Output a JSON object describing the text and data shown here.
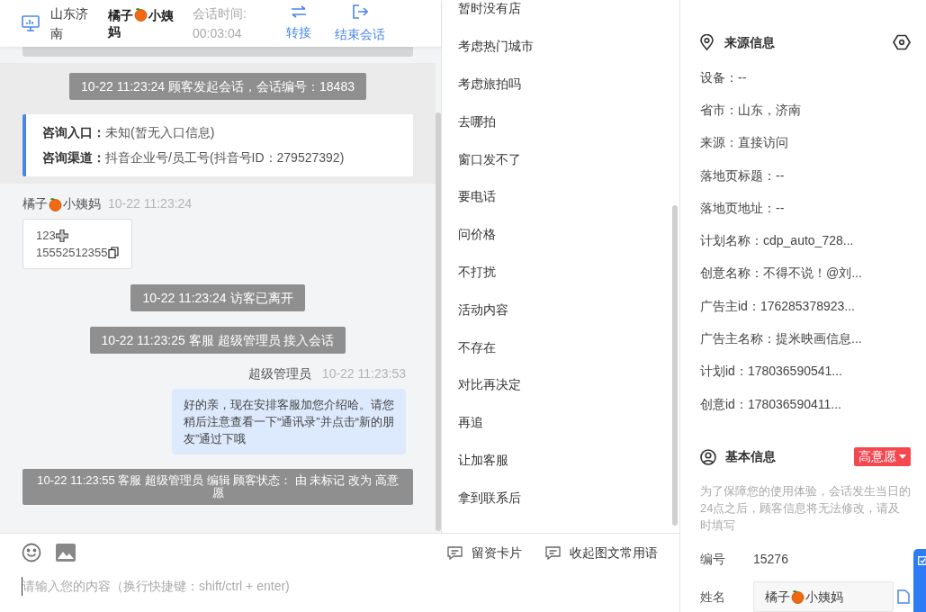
{
  "header": {
    "location": "山东济南",
    "customer_name_parts": [
      "橘子",
      "小姨",
      "妈"
    ],
    "timer_label": "会话时间:",
    "timer_value": "00:03:04",
    "actions": [
      {
        "kind": "transfer",
        "label": "转接"
      },
      {
        "kind": "end",
        "label": "结束会话"
      }
    ]
  },
  "chat": {
    "messages": [
      {
        "kind": "cutoff"
      },
      {
        "kind": "system_group",
        "text": "10-22 11:23:24 顾客发起会话，会话编号：18483",
        "card": [
          {
            "label": "咨询入口：",
            "value": "未知(暂无入口信息)"
          },
          {
            "label": "咨询渠道：",
            "value": "抖音企业号/员工号(抖音号ID：279527392)"
          }
        ]
      },
      {
        "kind": "customer",
        "name_parts": [
          "橘子",
          "小姨妈"
        ],
        "time": "10-22 11:23:24",
        "lines": [
          "123",
          "15552512355"
        ]
      },
      {
        "kind": "system",
        "text": "10-22 11:23:24 访客已离开"
      },
      {
        "kind": "system",
        "text": "10-22 11:23:25 客服 超级管理员 接入会话"
      },
      {
        "kind": "agent",
        "name": "超级管理员",
        "time": "10-22 11:23:53",
        "text": "好的亲，现在安排客服加您介绍哈。请您稍后注意查看一下“通讯录”并点击“新的朋友”通过下哦"
      },
      {
        "kind": "system_wide",
        "text": "10-22 11:23:55 客服 超级管理员 编辑 顾客状态： 由 未标记 改为 高意愿"
      }
    ]
  },
  "phrases": [
    "暂时没有店",
    "考虑热门城市",
    "考虑旅拍吗",
    "去哪拍",
    "窗口发不了",
    "要电话",
    "问价格",
    "不打扰",
    "活动内容",
    "不存在",
    "对比再决定",
    "再追",
    "让加客服",
    "拿到联系后"
  ],
  "composer": {
    "tools": [
      {
        "label": "留资卡片"
      },
      {
        "label": "收起图文常用语"
      }
    ],
    "placeholder": "请输入您的内容（换行快捷键：shift/ctrl + enter)"
  },
  "source_info": {
    "title": "来源信息",
    "rows": [
      "设备：--",
      "省市：山东，济南",
      "来源：直接访问",
      "落地页标题：--",
      "落地页地址：--",
      "计划名称：cdp_auto_728...",
      "创意名称：不得不说！@刘...",
      "广告主id：176285378923...",
      "广告主名称：提米映画信息...",
      "计划id：178036590541...",
      "创意id：178036590411..."
    ]
  },
  "basic_info": {
    "title": "基本信息",
    "tag": "高意愿",
    "note": "为了保障您的使用体验，会话发生当日的24点之后，顾客信息将无法修改，请及时填写",
    "fields": [
      {
        "kind": "text",
        "label": "编号",
        "value": "15276"
      },
      {
        "kind": "input",
        "label": "姓名",
        "value_parts": [
          "橘子",
          "小姨妈"
        ]
      }
    ]
  }
}
